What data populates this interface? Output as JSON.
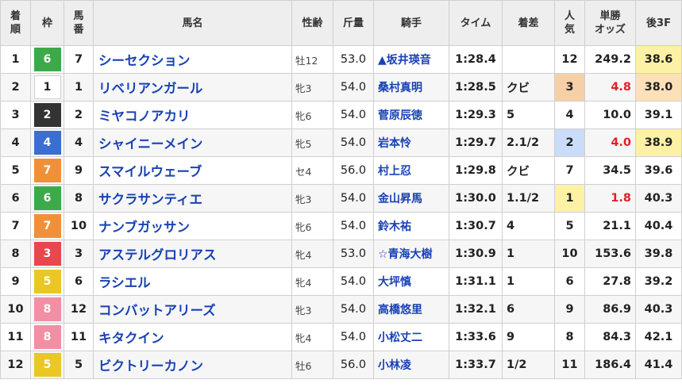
{
  "headers": {
    "rank": "着\n順",
    "waku": "枠",
    "umaban": "馬\n番",
    "name": "馬名",
    "sexage": "性齢",
    "weight": "斤量",
    "jockey": "騎手",
    "time": "タイム",
    "margin": "着差",
    "pop": "人\n気",
    "odds": "単勝\nオッズ",
    "last3f": "後3F"
  },
  "colors": {
    "waku": {
      "1": {
        "bg": "#ffffff",
        "fg": "#222222"
      },
      "2": {
        "bg": "#333333",
        "fg": "#ffffff"
      },
      "3": {
        "bg": "#e8474c",
        "fg": "#ffffff"
      },
      "4": {
        "bg": "#3a6fd1",
        "fg": "#ffffff"
      },
      "5": {
        "bg": "#eac725",
        "fg": "#ffffff"
      },
      "6": {
        "bg": "#3daa4a",
        "fg": "#ffffff"
      },
      "7": {
        "bg": "#f0913a",
        "fg": "#ffffff"
      },
      "8": {
        "bg": "#f28fa4",
        "fg": "#ffffff"
      }
    },
    "pop": {
      "1": "#fdf1a6",
      "2": "#c9dcfa",
      "3": "#f7cfa7"
    },
    "last3f": {
      "1": "#fde0b9",
      "2": "#fdf1a6",
      "3": "#fdf1a6"
    },
    "odds_red": "#e2202a"
  },
  "rows": [
    {
      "rank": "1",
      "waku": "6",
      "umaban": "7",
      "name": "シーセクション",
      "sexage": "牡12",
      "weight": "53.0",
      "jockey": "▲坂井瑛音",
      "time": "1:28.4",
      "margin": "",
      "pop": "12",
      "odds": "249.2",
      "last3f": "38.6",
      "pop_hl": false,
      "odds_red": false,
      "last3f_rank": "2"
    },
    {
      "rank": "2",
      "waku": "1",
      "umaban": "1",
      "name": "リベリアンガール",
      "sexage": "牝3",
      "weight": "54.0",
      "jockey": "桑村真明",
      "time": "1:28.5",
      "margin": "クビ",
      "pop": "3",
      "odds": "4.8",
      "last3f": "38.0",
      "pop_hl": true,
      "odds_red": true,
      "last3f_rank": "1"
    },
    {
      "rank": "3",
      "waku": "2",
      "umaban": "2",
      "name": "ミヤコノアカリ",
      "sexage": "牝6",
      "weight": "54.0",
      "jockey": "菅原辰徳",
      "time": "1:29.3",
      "margin": "5",
      "pop": "4",
      "odds": "10.0",
      "last3f": "39.1",
      "pop_hl": false,
      "odds_red": false,
      "last3f_rank": ""
    },
    {
      "rank": "4",
      "waku": "4",
      "umaban": "4",
      "name": "シャイニーメイン",
      "sexage": "牝5",
      "weight": "54.0",
      "jockey": "岩本怜",
      "time": "1:29.7",
      "margin": "2.1/2",
      "pop": "2",
      "odds": "4.0",
      "last3f": "38.9",
      "pop_hl": true,
      "odds_red": true,
      "last3f_rank": "3"
    },
    {
      "rank": "5",
      "waku": "7",
      "umaban": "9",
      "name": "スマイルウェーブ",
      "sexage": "セ4",
      "weight": "56.0",
      "jockey": "村上忍",
      "time": "1:29.8",
      "margin": "クビ",
      "pop": "7",
      "odds": "34.5",
      "last3f": "39.6",
      "pop_hl": false,
      "odds_red": false,
      "last3f_rank": ""
    },
    {
      "rank": "6",
      "waku": "6",
      "umaban": "8",
      "name": "サクラサンティエ",
      "sexage": "牝3",
      "weight": "54.0",
      "jockey": "金山昇馬",
      "time": "1:30.0",
      "margin": "1.1/2",
      "pop": "1",
      "odds": "1.8",
      "last3f": "40.3",
      "pop_hl": true,
      "odds_red": true,
      "last3f_rank": ""
    },
    {
      "rank": "7",
      "waku": "7",
      "umaban": "10",
      "name": "ナンブガッサン",
      "sexage": "牝6",
      "weight": "54.0",
      "jockey": "鈴木祐",
      "time": "1:30.7",
      "margin": "4",
      "pop": "5",
      "odds": "21.1",
      "last3f": "40.4",
      "pop_hl": false,
      "odds_red": false,
      "last3f_rank": ""
    },
    {
      "rank": "8",
      "waku": "3",
      "umaban": "3",
      "name": "アステルグロリアス",
      "sexage": "牝4",
      "weight": "53.0",
      "jockey": "☆青海大樹",
      "time": "1:30.9",
      "margin": "1",
      "pop": "10",
      "odds": "153.6",
      "last3f": "39.8",
      "pop_hl": false,
      "odds_red": false,
      "last3f_rank": ""
    },
    {
      "rank": "9",
      "waku": "5",
      "umaban": "6",
      "name": "ラシエル",
      "sexage": "牝4",
      "weight": "54.0",
      "jockey": "大坪慎",
      "time": "1:31.1",
      "margin": "1",
      "pop": "6",
      "odds": "27.8",
      "last3f": "39.2",
      "pop_hl": false,
      "odds_red": false,
      "last3f_rank": ""
    },
    {
      "rank": "10",
      "waku": "8",
      "umaban": "12",
      "name": "コンバットアリーズ",
      "sexage": "牝3",
      "weight": "54.0",
      "jockey": "高橋悠里",
      "time": "1:32.1",
      "margin": "6",
      "pop": "9",
      "odds": "86.9",
      "last3f": "40.3",
      "pop_hl": false,
      "odds_red": false,
      "last3f_rank": ""
    },
    {
      "rank": "11",
      "waku": "8",
      "umaban": "11",
      "name": "キタクイン",
      "sexage": "牝4",
      "weight": "54.0",
      "jockey": "小松丈二",
      "time": "1:33.6",
      "margin": "9",
      "pop": "8",
      "odds": "84.3",
      "last3f": "42.1",
      "pop_hl": false,
      "odds_red": false,
      "last3f_rank": ""
    },
    {
      "rank": "12",
      "waku": "5",
      "umaban": "5",
      "name": "ビクトリーカノン",
      "sexage": "牡6",
      "weight": "56.0",
      "jockey": "小林凌",
      "time": "1:33.7",
      "margin": "1/2",
      "pop": "11",
      "odds": "186.4",
      "last3f": "41.4",
      "pop_hl": false,
      "odds_red": false,
      "last3f_rank": ""
    }
  ]
}
